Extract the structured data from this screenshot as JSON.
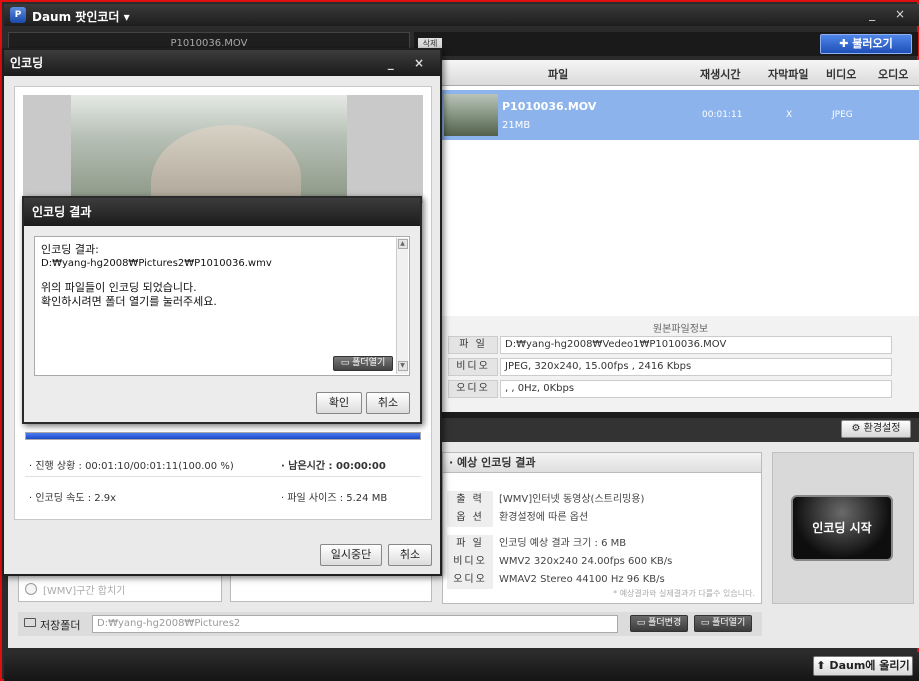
{
  "app": {
    "title": "Daum 팟인코더 ▾",
    "logo_text": "P",
    "window_controls": "_ ×"
  },
  "left_panel": {
    "file_label": "P1010036.MOV"
  },
  "toolbar": {
    "delete_label": "삭제",
    "import_label": "✚ 불러오기"
  },
  "file_list": {
    "columns": [
      "파일",
      "재생시간",
      "자막파일",
      "비디오",
      "오디오"
    ],
    "rows": [
      {
        "name": "P1010036.MOV",
        "size": "21MB",
        "duration": "00:01:11",
        "subtitle": "X",
        "video": "JPEG"
      }
    ]
  },
  "original_info": {
    "title": "원본파일정보",
    "file_label": "파 일",
    "file_value": "D:₩yang-hg2008₩Vedeo1₩P1010036.MOV",
    "video_label": "비디오",
    "video_value": "JPEG, 320x240, 15.00fps , 2416 Kbps",
    "audio_label": "오디오",
    "audio_value": ", , 0Hz, 0Kbps"
  },
  "settings_button": "⚙ 환경설정",
  "expected": {
    "title": "· 예상 인코딩 결과",
    "output_label": "출 력",
    "output_value": "[WMV]인터넷 동영상(스트리밍용)",
    "option_label": "옵 션",
    "option_value": "환경설정에 따른 옵션",
    "file_label": "파 일",
    "file_value": "인코딩 예상 결과 크기 : 6 MB",
    "video_label": "비디오",
    "video_value": "WMV2 320x240 24.00fps  600 KB/s",
    "audio_label": "오디오",
    "audio_value": "WMAV2 Stereo 44100 Hz 96 KB/s",
    "note": "* 예상결과와 실제결과가 다를수 있습니다."
  },
  "start_button": "인코딩 시작",
  "merge_option": "[WMV]구간 합치기",
  "save": {
    "label": "저장폴더",
    "path": "D:₩yang-hg2008₩Pictures2",
    "change_folder": "▭ 폴더변경",
    "open_folder": "▭ 폴더열기"
  },
  "upload_button": "⬆ Daum에 올리기",
  "encoding_dialog": {
    "title": "인코딩",
    "controls": "_ ×",
    "progress_percent": 100,
    "status_label": "· 진행 상황 : 00:01:10/00:01:11(100.00 %)",
    "remaining_label": "· 남은시간 : 00:00:00",
    "speed_label": "· 인코딩 속도 : 2.9x",
    "filesize_label": "· 파일 사이즈 : 5.24 MB",
    "pause_button": "일시중단",
    "cancel_button": "취소"
  },
  "result_dialog": {
    "title": "인코딩 결과",
    "line1": "인코딩 결과:",
    "line2": "D:₩yang-hg2008₩Pictures2₩P1010036.wmv",
    "line3": "위의 파일들이 인코딩 되었습니다.",
    "line4": "확인하시려면 폴더 열기를 눌러주세요.",
    "open_folder": "▭ 폴더열기",
    "ok_button": "확인",
    "cancel_button": "취소"
  }
}
